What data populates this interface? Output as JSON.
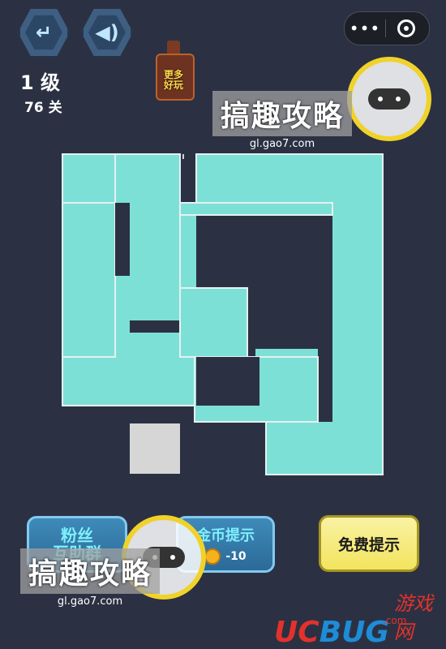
{
  "header": {
    "back_icon": "back-arrow-icon",
    "sound_icon": "speaker-icon",
    "level_label": "1 级",
    "stage_label": "76 关"
  },
  "capsule": {
    "more_glyph": "•••",
    "close_icon": "circle-dot-icon"
  },
  "more_games": {
    "label_line1": "更多",
    "label_line2": "好玩"
  },
  "board": {
    "path_color": "#7de0d6",
    "empty_cell_color": "#d6d6d6",
    "background": "#2b3143"
  },
  "buttons": {
    "fans_line1": "粉丝",
    "fans_line2": "互助群",
    "coin_hint_label": "金币提示",
    "coin_cost": "-10",
    "free_hint_label": "免费提示"
  },
  "watermark": {
    "brand": "搞趣攻略",
    "url": "gl.gao7.com"
  },
  "site_logo": {
    "uc": "UC",
    "bug": "BUG",
    "cn": "游戏网",
    "com": ".com"
  },
  "colors": {
    "button_blue": "#3f8ab9",
    "button_yellow": "#f2e45e",
    "ring_yellow": "#f0d22a"
  }
}
